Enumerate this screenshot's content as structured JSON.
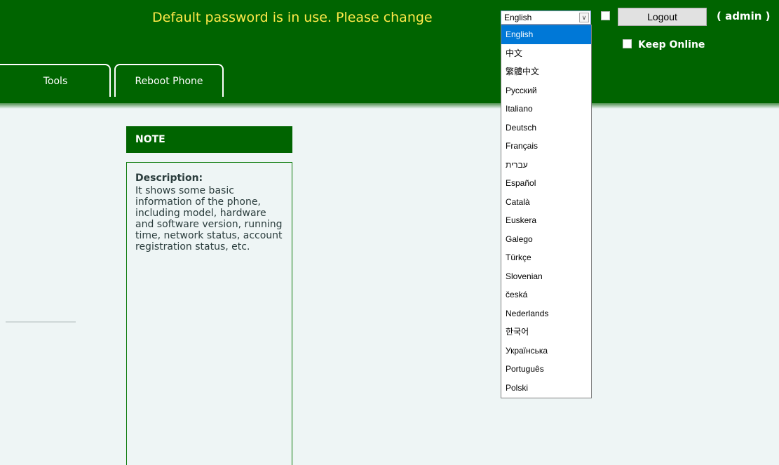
{
  "header": {
    "warning": "Default password is in use. Please change",
    "language_selected": "English",
    "logout_label": "Logout",
    "user_label": "( admin )",
    "keep_online_label": "Keep Online"
  },
  "tabs": [
    {
      "label": "Tools"
    },
    {
      "label": "Reboot Phone"
    }
  ],
  "note": {
    "header": "NOTE",
    "title": "Description:",
    "text": "It shows some basic information of the phone, including model, hardware and software version, running time, network status, account registration status, etc."
  },
  "language_options": [
    "English",
    "中文",
    "繁體中文",
    "Русский",
    "Italiano",
    "Deutsch",
    "Français",
    "עברית",
    "Español",
    "Català",
    "Euskera",
    "Galego",
    "Türkçe",
    "Slovenian",
    "česká",
    "Nederlands",
    "한국어",
    "Українська",
    "Português",
    "Polski"
  ],
  "colors": {
    "header_green": "#006400",
    "warning_yellow": "#ffe94a",
    "selection_blue": "#0078d7",
    "page_background": "#eef5f5"
  }
}
